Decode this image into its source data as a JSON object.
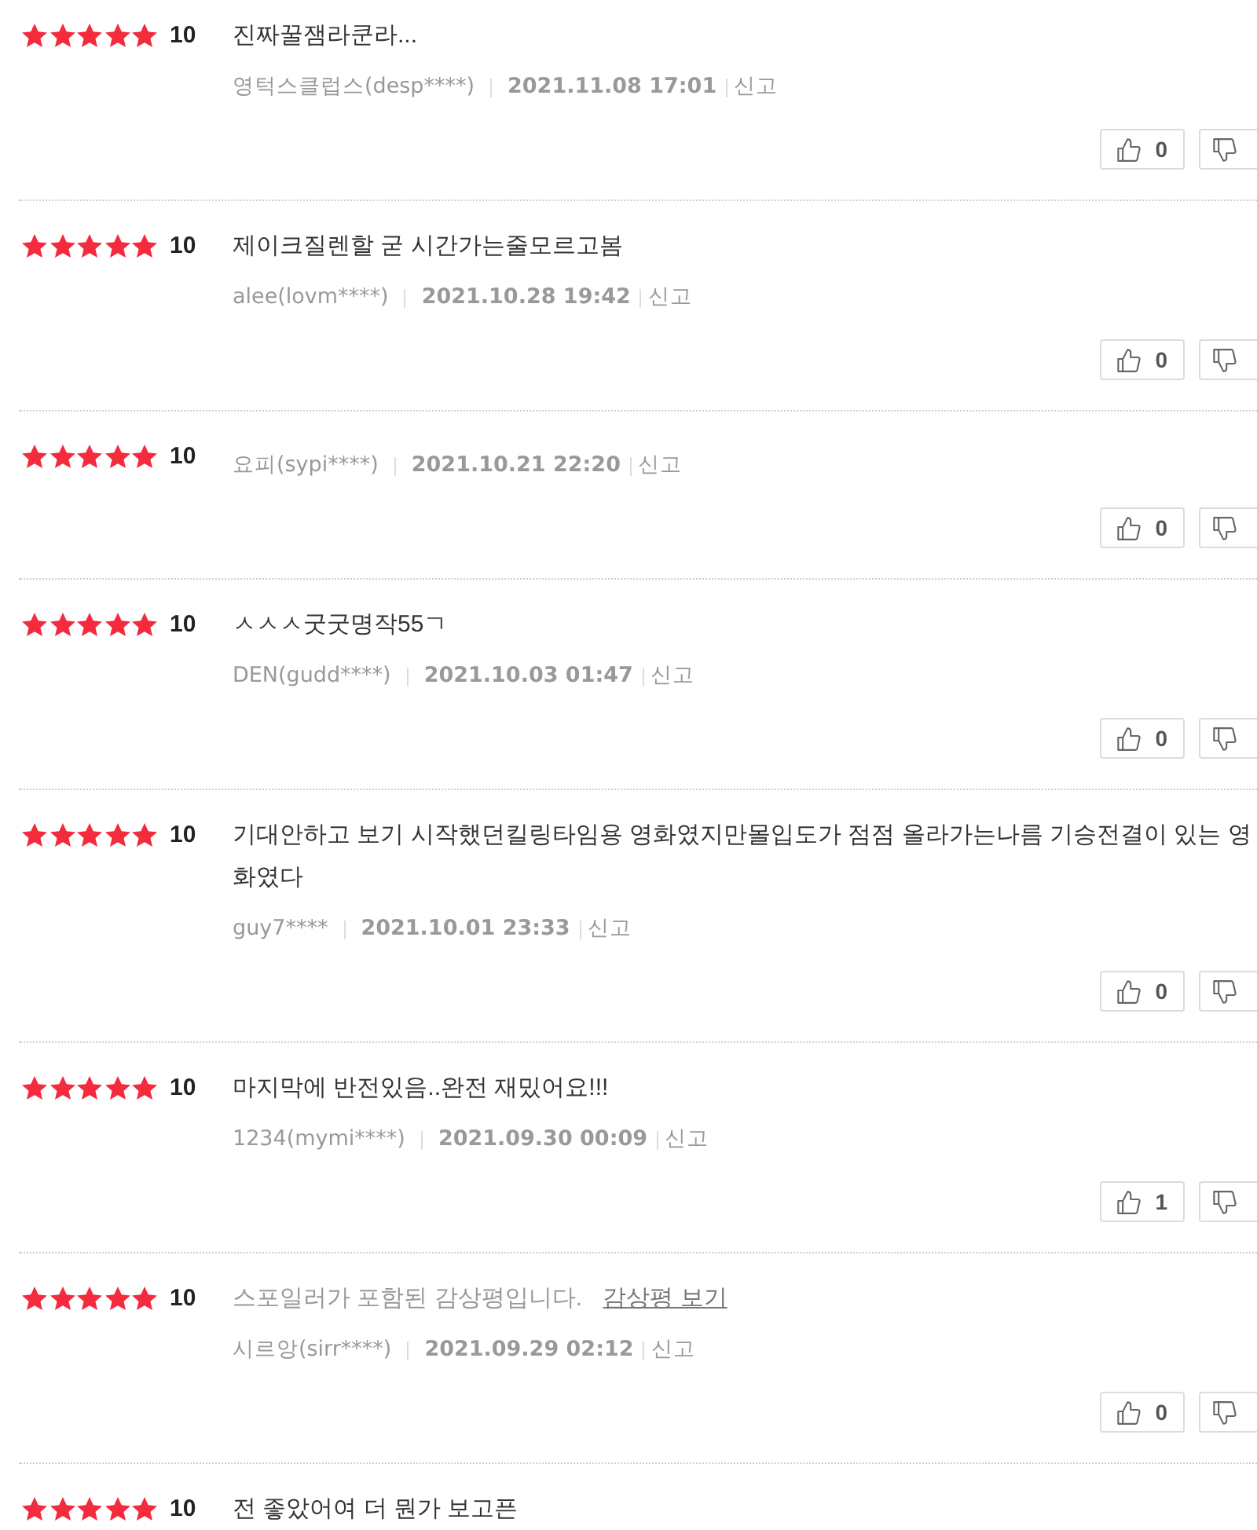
{
  "reviews": [
    {
      "kind": "review",
      "stars": 5,
      "score": "10",
      "text": "진짜꿀잼라쿤라...",
      "author": "영턱스클럽스(desp****)",
      "date": "2021.11.08 17:01",
      "report": "신고",
      "likes": "0"
    },
    {
      "kind": "review",
      "stars": 5,
      "score": "10",
      "text": "제이크질렌할 굳 시간가는줄모르고봄",
      "author": "alee(lovm****)",
      "date": "2021.10.28 19:42",
      "report": "신고",
      "likes": "0"
    },
    {
      "kind": "review",
      "stars": 5,
      "score": "10",
      "author": "요피(sypi****)",
      "date": "2021.10.21 22:20",
      "report": "신고",
      "likes": "0"
    },
    {
      "kind": "review",
      "stars": 5,
      "score": "10",
      "text": "ㅅㅅㅅ굿굿명작55ㄱ",
      "author": "DEN(gudd****)",
      "date": "2021.10.03 01:47",
      "report": "신고",
      "likes": "0"
    },
    {
      "kind": "review",
      "stars": 5,
      "score": "10",
      "text": "기대안하고 보기 시작했던킬링타임용 영화였지만몰입도가 점점 올라가는나름 기승전결이 있는 영화였다",
      "author": "guy7****",
      "date": "2021.10.01 23:33",
      "report": "신고",
      "likes": "0"
    },
    {
      "kind": "review",
      "stars": 5,
      "score": "10",
      "text": "마지막에 반전있음..완전 재밌어요!!!",
      "author": "1234(mymi****)",
      "date": "2021.09.30 00:09",
      "report": "신고",
      "likes": "1"
    },
    {
      "kind": "spoiler",
      "stars": 5,
      "score": "10",
      "spoiler_notice": "스포일러가 포함된 감상평입니다.",
      "spoiler_link": "감상평 보기",
      "author": "시르앙(sirr****)",
      "date": "2021.09.29 02:12",
      "report": "신고",
      "likes": "0"
    },
    {
      "kind": "review",
      "stars": 5,
      "score": "10",
      "text": "전 좋았어여 더 뭔가 보고픈"
    }
  ]
}
